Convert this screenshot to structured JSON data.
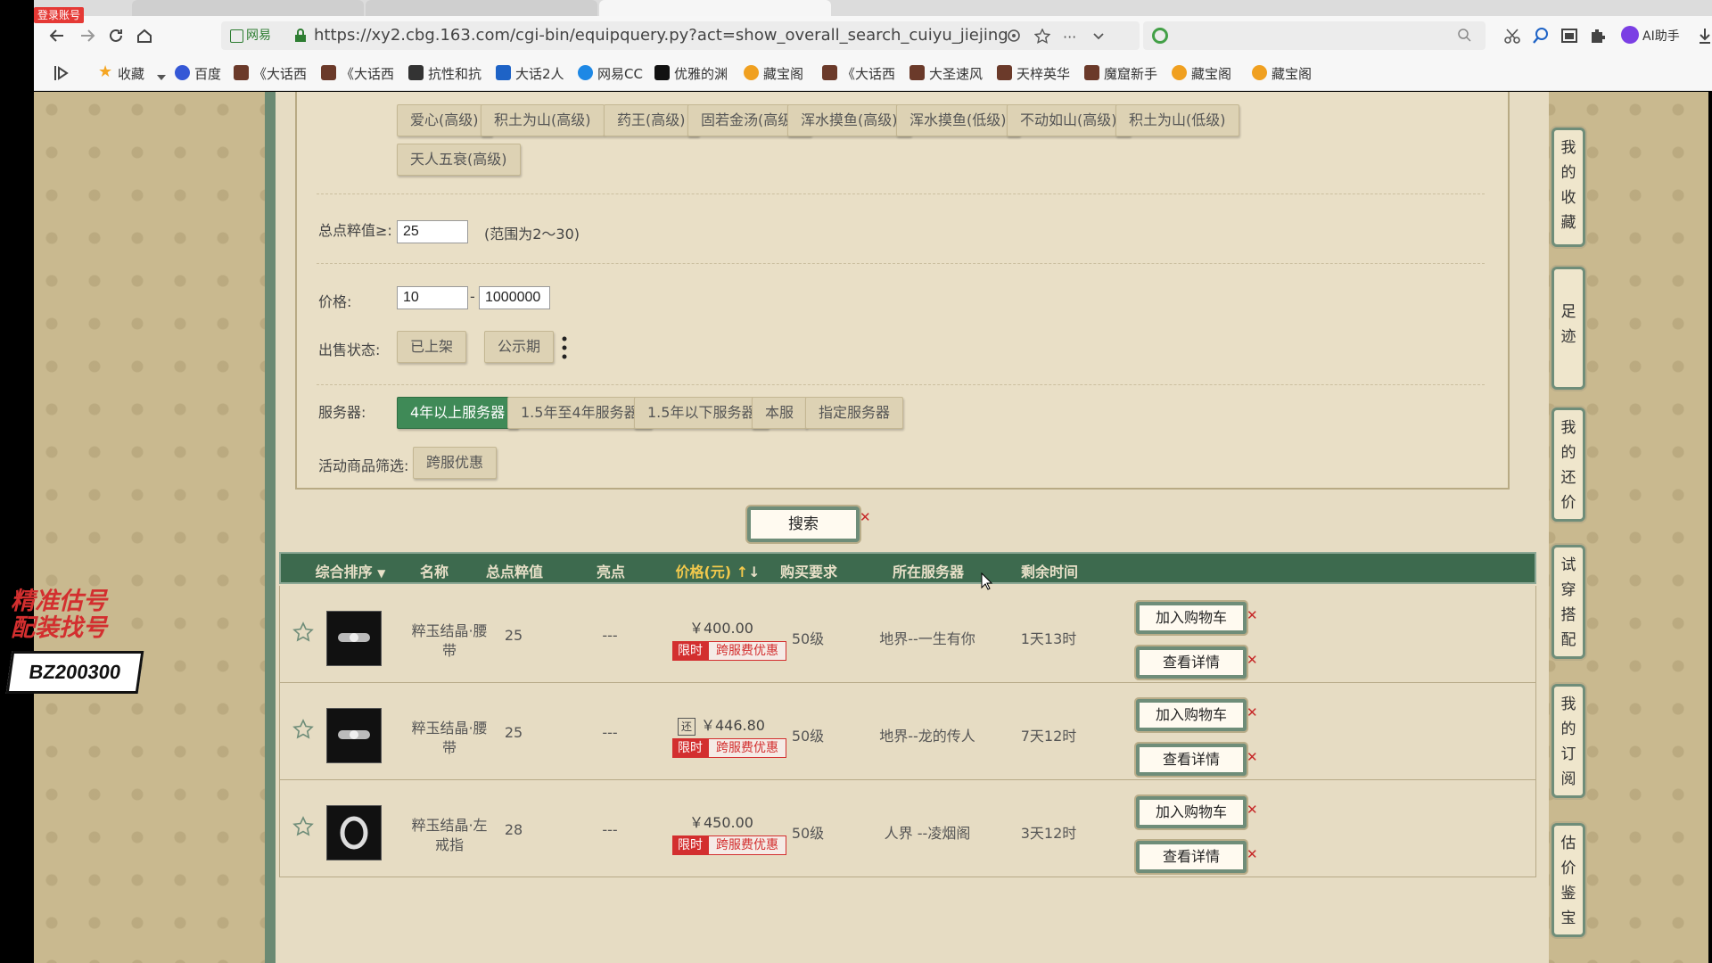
{
  "browser": {
    "login_badge": "登录账号",
    "site_badge": "网易",
    "url": "https://xy2.cbg.163.com/cgi-bin/equipquery.py?act=show_overall_search_cuiyu_jiejing",
    "search_placeholder": "",
    "ai_helper": "AI助手",
    "bookmarks": [
      "收藏",
      "百度",
      "《大话西",
      "《大话西",
      "抗性和抗",
      "大话2人",
      "网易CC",
      "优雅的渊",
      "藏宝阁",
      "《大话西",
      "大圣速风",
      "天梓英华",
      "魔窟新手",
      "藏宝阁",
      "藏宝阁"
    ]
  },
  "filters": {
    "skill_chips": [
      "爱心(高级)",
      "积土为山(高级)",
      "药王(高级)",
      "固若金汤(高级)",
      "浑水摸鱼(高级)",
      "浑水摸鱼(低级)",
      "不动如山(高级)",
      "积土为山(低级)",
      "天人五衰(高级)"
    ],
    "points_label": "总点粹值≥:",
    "points_value": "25",
    "points_hint": "(范围为2～30)",
    "price_label": "价格:",
    "price_min": "10",
    "price_dash": "-",
    "price_max": "1000000",
    "sale_status_label": "出售状态:",
    "sale_status_options": [
      "已上架",
      "公示期"
    ],
    "server_label": "服务器:",
    "server_options": [
      "4年以上服务器",
      "1.5年至4年服务器",
      "1.5年以下服务器",
      "本服",
      "指定服务器"
    ],
    "server_selected_index": 0,
    "activity_label": "活动商品筛选:",
    "activity_option": "跨服优惠"
  },
  "search_button": "搜索",
  "table": {
    "headers": [
      "综合排序",
      "名称",
      "总点粹值",
      "亮点",
      "价格(元)",
      "购买要求",
      "所在服务器",
      "剩余时间"
    ],
    "rows": [
      {
        "name": "粹玉结晶·腰带",
        "points": "25",
        "highlight": "---",
        "price": "￥400.00",
        "deposit_icon": "",
        "limit": "限时",
        "promo": "跨服费优惠",
        "req": "50级",
        "server": "地界--一生有你",
        "time": "1天13时",
        "add_cart": "加入购物车",
        "detail": "查看详情"
      },
      {
        "name": "粹玉结晶·腰带",
        "points": "25",
        "highlight": "---",
        "price": "￥446.80",
        "deposit_icon": "还",
        "limit": "限时",
        "promo": "跨服费优惠",
        "req": "50级",
        "server": "地界--龙的传人",
        "time": "7天12时",
        "add_cart": "加入购物车",
        "detail": "查看详情"
      },
      {
        "name": "粹玉结晶·左戒指",
        "points": "28",
        "highlight": "---",
        "price": "￥450.00",
        "deposit_icon": "",
        "limit": "限时",
        "promo": "跨服费优惠",
        "req": "50级",
        "server": "人界 --凌烟阁",
        "time": "3天12时",
        "add_cart": "加入购物车",
        "detail": "查看详情"
      }
    ]
  },
  "sidebar": [
    "我的收藏",
    "足迹",
    "我的还价",
    "试穿搭配",
    "我的订阅",
    "估价鉴宝"
  ],
  "overlay": {
    "line1": "精准估号",
    "line2": "配装找号",
    "code": "BZ200300"
  }
}
